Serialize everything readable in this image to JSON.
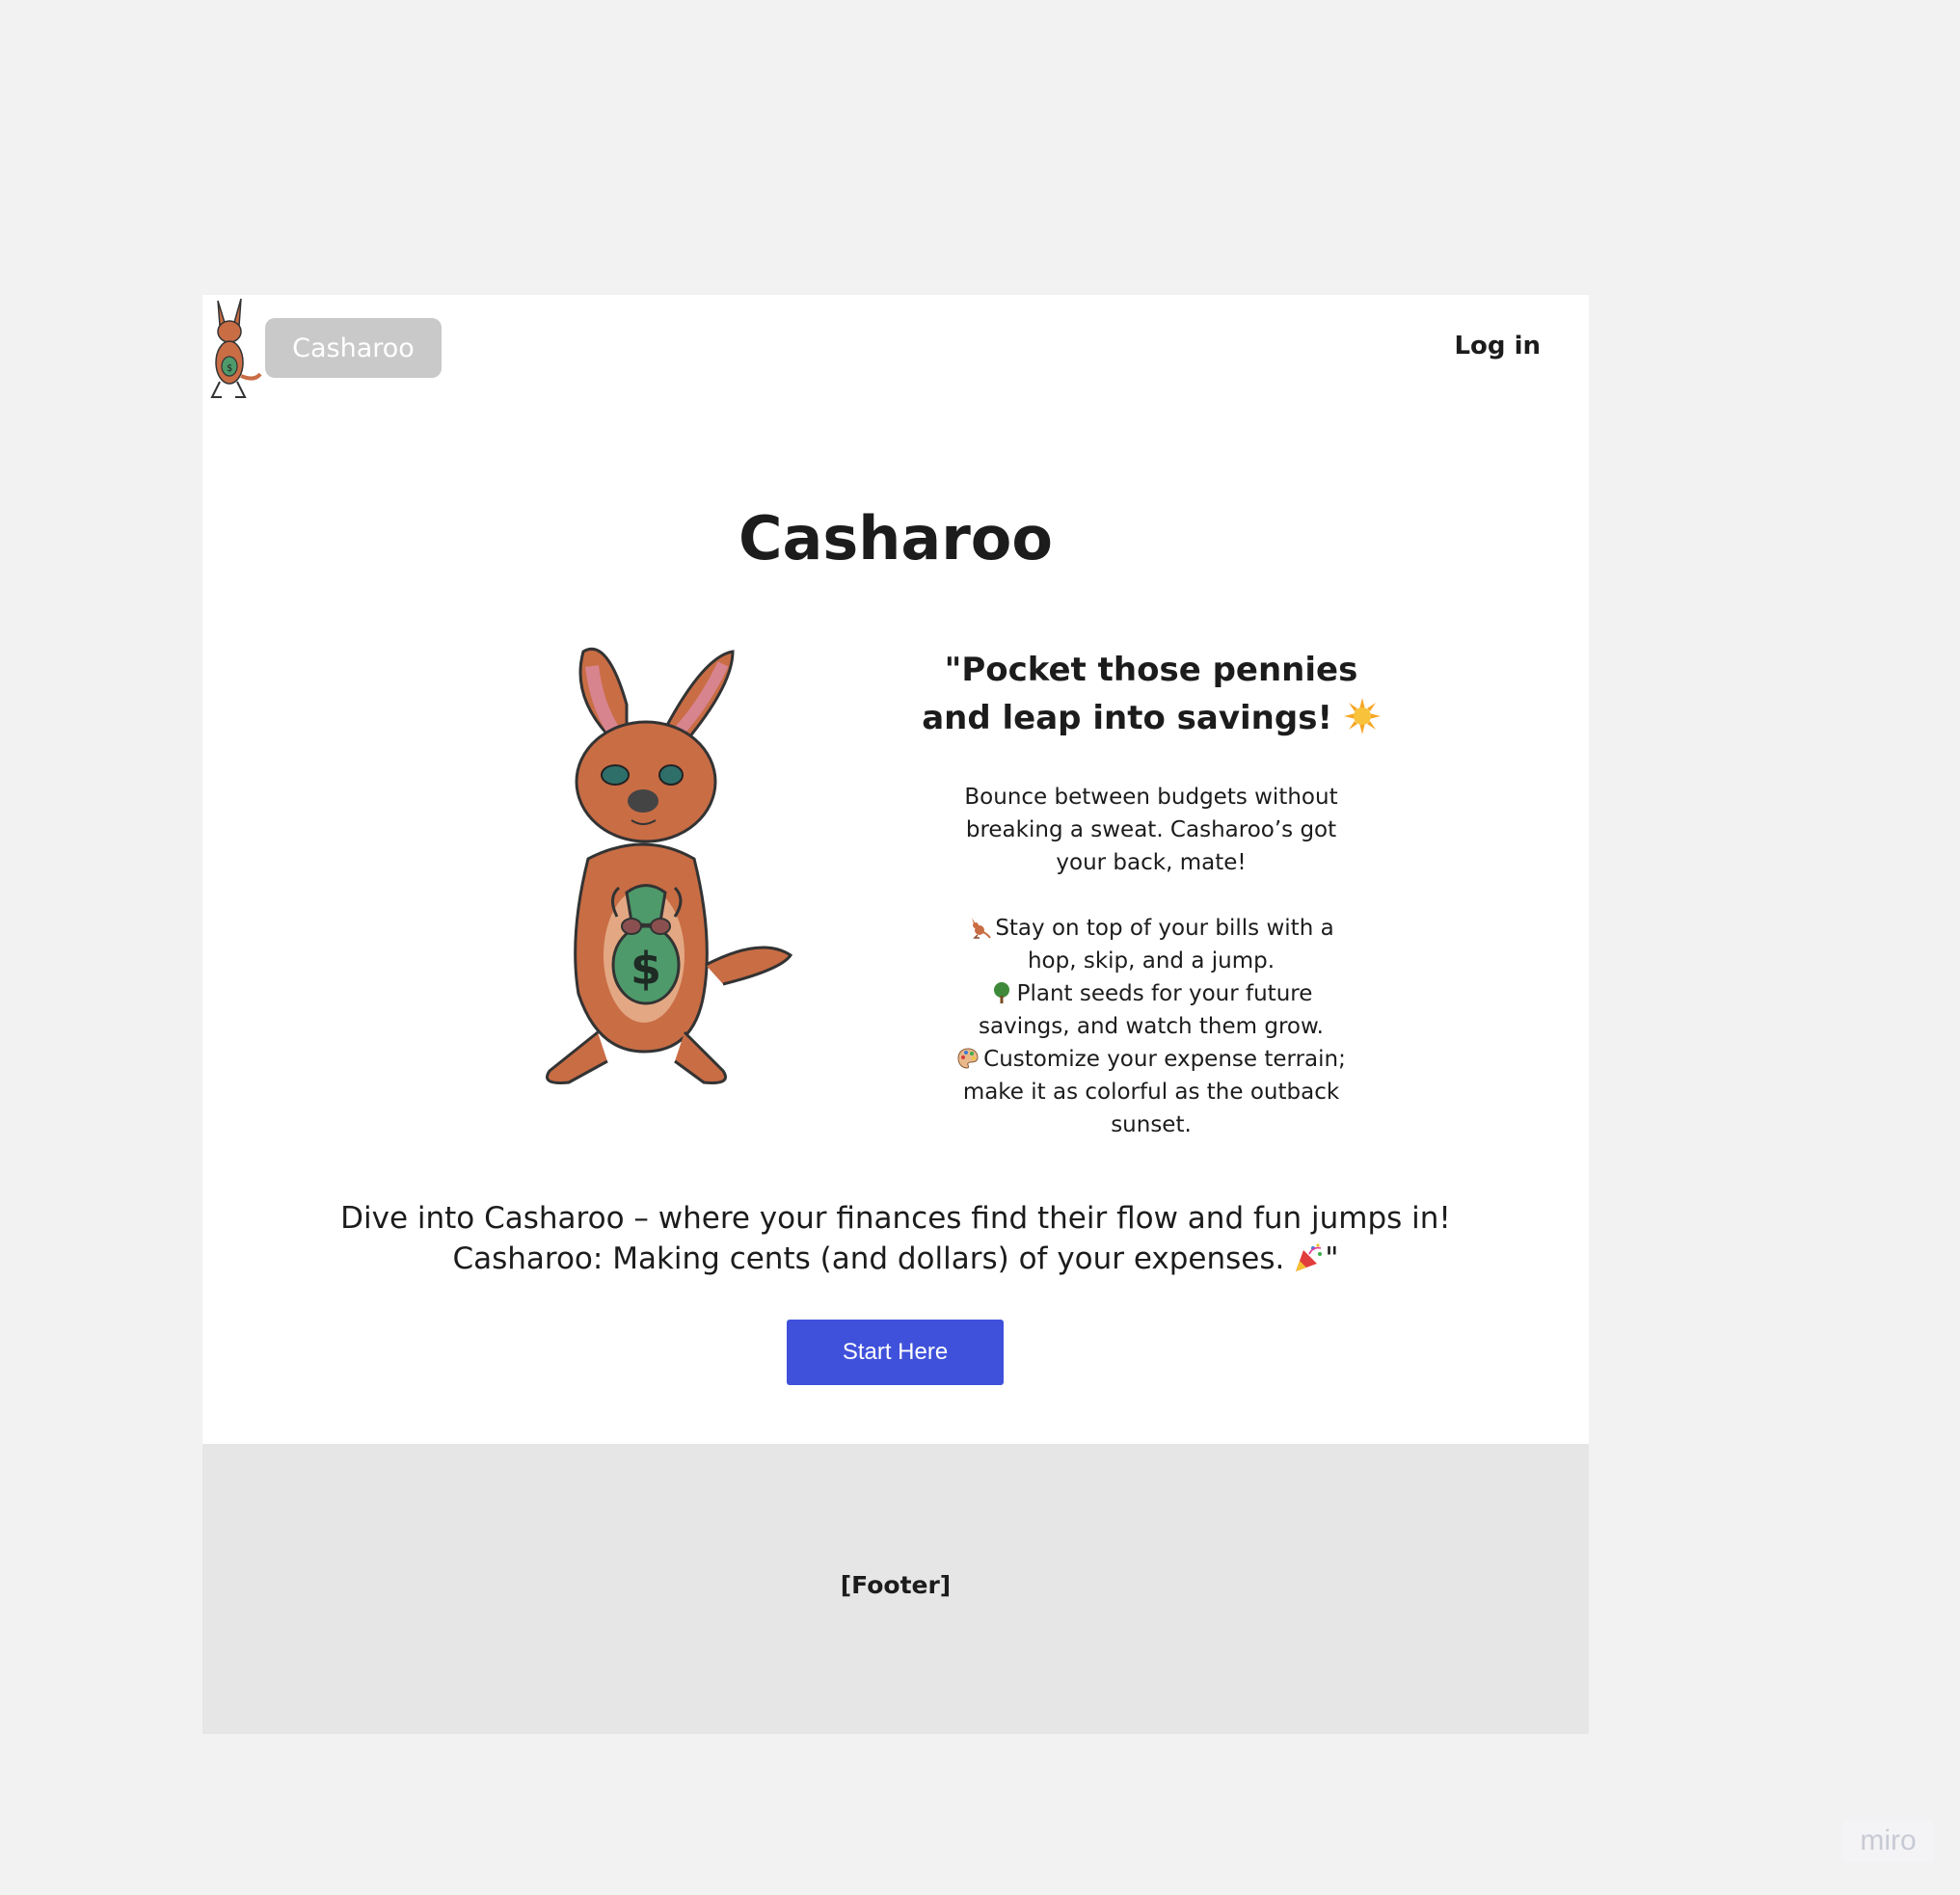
{
  "header": {
    "brand_label": "Casharoo",
    "login_label": "Log in"
  },
  "hero": {
    "title": "Casharoo",
    "tagline": "\"Pocket those pennies and leap into savings!",
    "description": "Bounce between budgets without breaking a sweat. Casharoo’s got your back, mate!",
    "features": [
      {
        "icon": "kangaroo-icon",
        "text": "Stay on top of your bills with a hop, skip, and a jump."
      },
      {
        "icon": "tree-icon",
        "text": "Plant seeds for your future savings, and watch them grow."
      },
      {
        "icon": "palette-icon",
        "text": "Customize your expense terrain; make it as colorful as the outback sunset."
      }
    ],
    "closing_line1": "Dive into Casharoo – where your finances find their flow and fun jumps in!",
    "closing_line2": "Casharoo: Making cents (and dollars) of your expenses.",
    "closing_quote": "\"",
    "cta_label": "Start Here"
  },
  "footer": {
    "label": "[Footer]"
  },
  "watermark": "miro",
  "colors": {
    "background": "#f2f2f2",
    "cta": "#3f51db",
    "brand_pill": "#c9c9c9",
    "footer": "#e6e6e6"
  }
}
